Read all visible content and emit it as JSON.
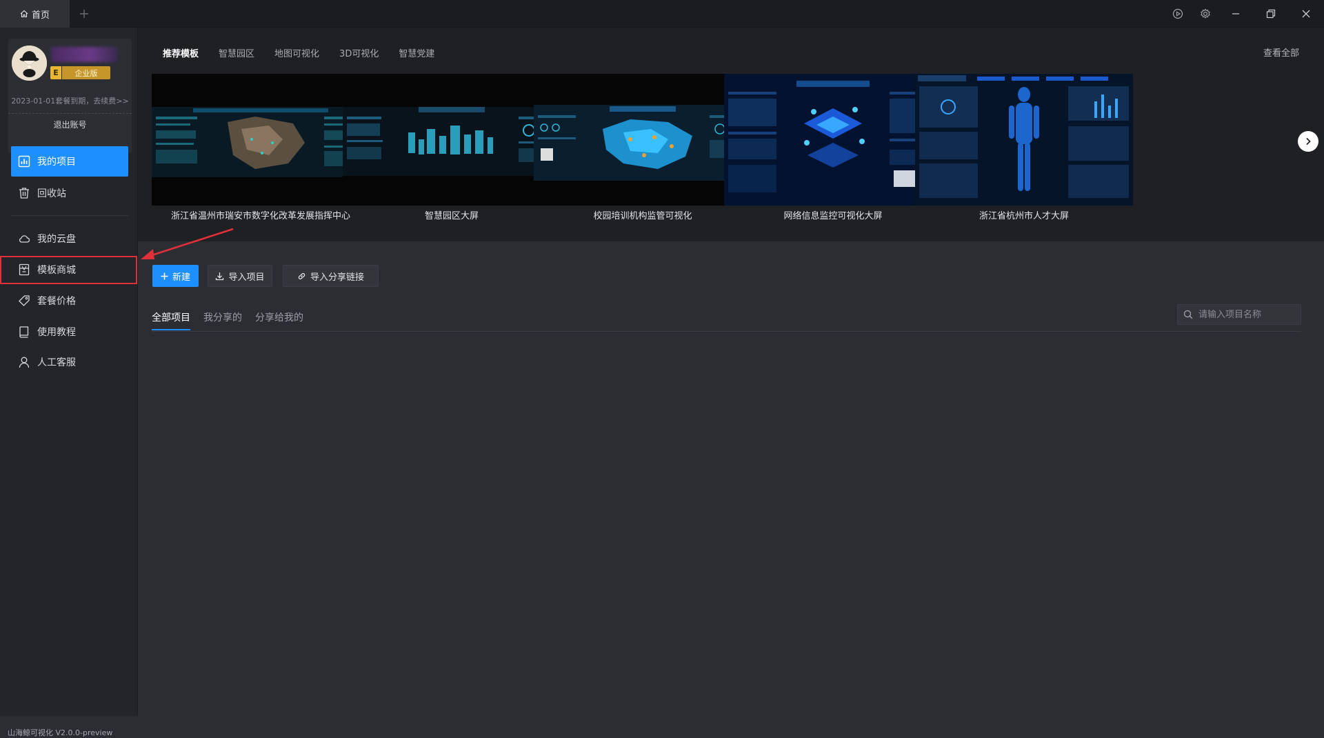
{
  "titlebar": {
    "home_tab": "首页",
    "add_tab_icon": "plus-icon",
    "controls": [
      "play-circle-icon",
      "settings-icon",
      "minimize-icon",
      "restore-icon",
      "close-icon"
    ]
  },
  "user": {
    "edition_letter": "E",
    "edition": "企业版",
    "expire_text": "2023-01-01套餐到期，去续费>>",
    "logout": "退出账号"
  },
  "sidebar": {
    "items": [
      {
        "label": "我的项目",
        "icon": "bar-chart-icon",
        "active": true
      },
      {
        "label": "回收站",
        "icon": "trash-icon",
        "active": false
      },
      {
        "label": "我的云盘",
        "icon": "cloud-icon",
        "active": false
      },
      {
        "label": "模板商城",
        "icon": "store-icon",
        "active": false
      },
      {
        "label": "套餐价格",
        "icon": "tag-icon",
        "active": false
      },
      {
        "label": "使用教程",
        "icon": "book-icon",
        "active": false
      },
      {
        "label": "人工客服",
        "icon": "user-icon",
        "active": false
      }
    ],
    "version": "山海鲸可视化 V2.0.0-preview"
  },
  "templates": {
    "tabs": [
      "推荐模板",
      "智慧园区",
      "地图可视化",
      "3D可视化",
      "智慧党建"
    ],
    "active_tab": 0,
    "view_all": "查看全部",
    "items": [
      {
        "title": "浙江省温州市瑞安市数字化改革发展指挥中心"
      },
      {
        "title": "智慧园区大屏"
      },
      {
        "title": "校园培训机构监管可视化"
      },
      {
        "title": "网络信息监控可视化大屏"
      },
      {
        "title": "浙江省杭州市人才大屏"
      }
    ],
    "next_icon": "chevron-right-icon"
  },
  "actions": {
    "new": "新建",
    "import_project": "导入项目",
    "import_link": "导入分享链接"
  },
  "projects": {
    "tabs": [
      "全部项目",
      "我分享的",
      "分享给我的"
    ],
    "active_tab": 0,
    "search_placeholder": "请输入项目名称"
  },
  "colors": {
    "accent": "#1e8fff",
    "annotation_red": "#e0303a",
    "badge_gold": "#c7962a"
  }
}
